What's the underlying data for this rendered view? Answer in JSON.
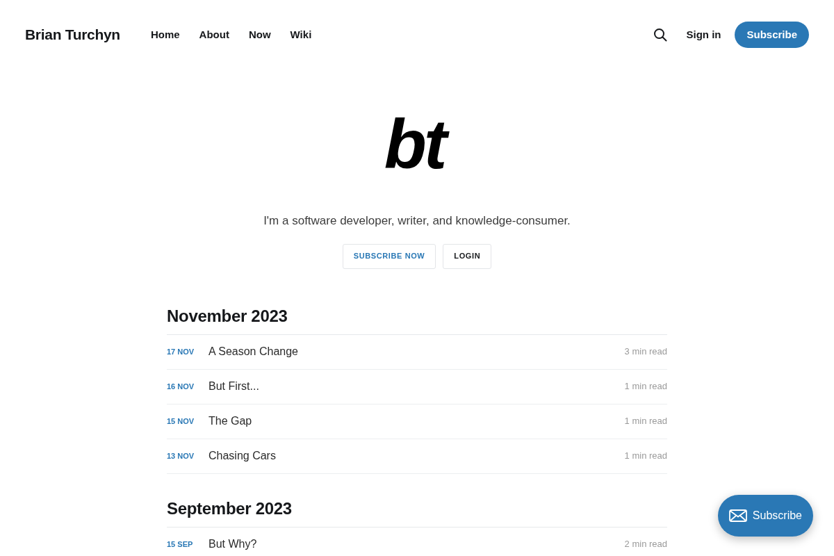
{
  "header": {
    "brand": "Brian Turchyn",
    "nav": [
      "Home",
      "About",
      "Now",
      "Wiki"
    ],
    "sign_in": "Sign in",
    "subscribe": "Subscribe"
  },
  "hero": {
    "logo": "bt",
    "tagline": "I'm a software developer, writer, and knowledge-consumer.",
    "buttons": [
      {
        "label": "SUBSCRIBE NOW",
        "kind": "primary"
      },
      {
        "label": "LOGIN",
        "kind": "secondary"
      }
    ]
  },
  "sections": [
    {
      "title": "November 2023",
      "posts": [
        {
          "date": "17 NOV",
          "title": "A Season Change",
          "reading_time": "3 min read"
        },
        {
          "date": "16 NOV",
          "title": "But First...",
          "reading_time": "1 min read"
        },
        {
          "date": "15 NOV",
          "title": "The Gap",
          "reading_time": "1 min read"
        },
        {
          "date": "13 NOV",
          "title": "Chasing Cars",
          "reading_time": "1 min read"
        }
      ]
    },
    {
      "title": "September 2023",
      "posts": [
        {
          "date": "15 SEP",
          "title": "But Why?",
          "reading_time": "2 min read"
        }
      ]
    }
  ],
  "floating_button": {
    "label": "Subscribe"
  }
}
